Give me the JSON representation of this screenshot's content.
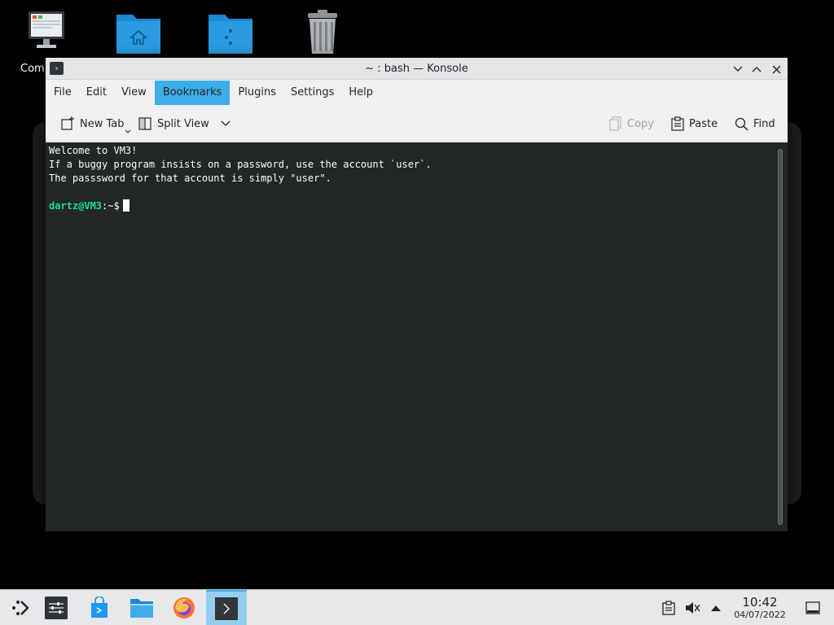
{
  "desktop": {
    "icons": [
      {
        "name": "computer",
        "label": "Computer"
      },
      {
        "name": "home-folder",
        "label": ""
      },
      {
        "name": "network-folder",
        "label": ""
      },
      {
        "name": "trash",
        "label": ""
      }
    ],
    "visible_label": "Comp"
  },
  "window": {
    "title": "~ : bash — Konsole",
    "app_icon": "›",
    "menu": [
      "File",
      "Edit",
      "View",
      "Bookmarks",
      "Plugins",
      "Settings",
      "Help"
    ],
    "active_menu": "Bookmarks",
    "toolbar": {
      "new_tab": "New Tab",
      "split_view": "Split View",
      "copy": "Copy",
      "paste": "Paste",
      "find": "Find"
    }
  },
  "terminal": {
    "lines": [
      "Welcome to VM3!",
      "If a buggy program insists on a password, use the account `user`.",
      "The passsword for that account is simply \"user\"."
    ],
    "prompt_user": "dartz@VM3",
    "prompt_sep": ":",
    "prompt_path": "~$"
  },
  "taskbar": {
    "time": "10:42",
    "date": "04/07/2022"
  },
  "colors": {
    "accent": "#3daee9",
    "terminal_bg": "#232627",
    "prompt_green": "#1cdc9a"
  }
}
